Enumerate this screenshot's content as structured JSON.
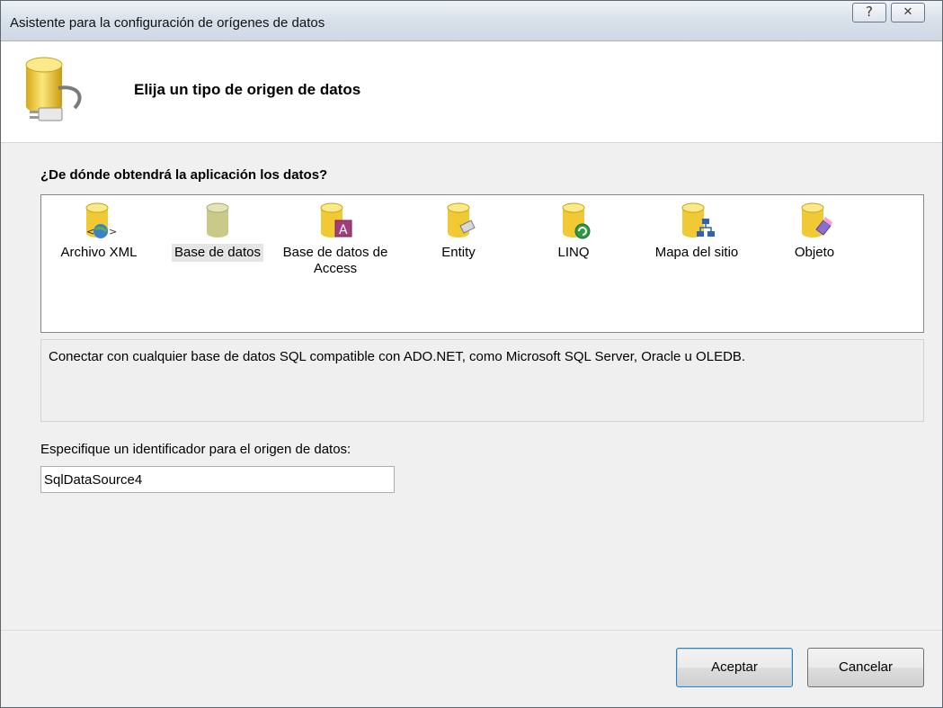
{
  "window": {
    "title": "Asistente para la configuración de orígenes de datos",
    "help_button": "?",
    "close_button": "✕"
  },
  "header": {
    "title": "Elija un tipo de origen de datos",
    "icon": "database-plug-icon"
  },
  "question": "¿De dónde obtendrá la aplicación los datos?",
  "data_sources": [
    {
      "label": "Archivo XML",
      "icon": "xml-database-icon",
      "selected": false
    },
    {
      "label": "Base de datos",
      "icon": "database-icon",
      "selected": true
    },
    {
      "label": "Base de datos de Access",
      "icon": "access-database-icon",
      "selected": false
    },
    {
      "label": "Entity",
      "icon": "entity-database-icon",
      "selected": false
    },
    {
      "label": "LINQ",
      "icon": "linq-database-icon",
      "selected": false
    },
    {
      "label": "Mapa del sitio",
      "icon": "sitemap-database-icon",
      "selected": false
    },
    {
      "label": "Objeto",
      "icon": "object-database-icon",
      "selected": false
    }
  ],
  "description": "Conectar con cualquier base de datos SQL compatible con ADO.NET, como Microsoft SQL Server, Oracle u OLEDB.",
  "identifier": {
    "label": "Especifique un identificador para el origen de datos:",
    "value": "SqlDataSource4"
  },
  "buttons": {
    "ok": "Aceptar",
    "cancel": "Cancelar"
  },
  "colors": {
    "db_yellow": "#f3cf3a",
    "selection_bg": "#e5e5e5",
    "default_button_border": "#3c7fb1"
  }
}
